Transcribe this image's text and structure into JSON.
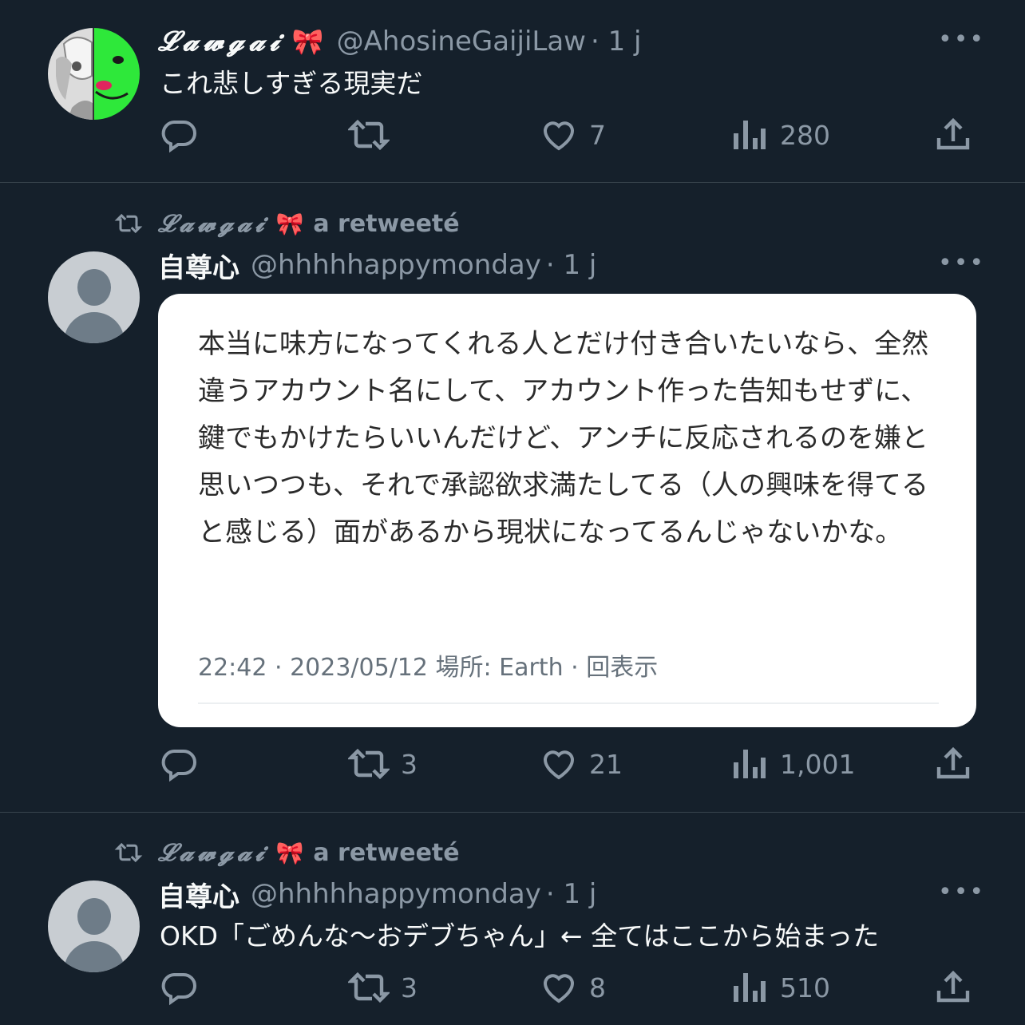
{
  "colors": {
    "background": "#15202b",
    "text_primary": "#f7f9f9",
    "text_secondary": "#8b98a5",
    "divider": "#38444d",
    "card_background": "#ffffff",
    "bow_pink": "#ff7aa8"
  },
  "tweets": [
    {
      "display_name": "𝓛𝓪𝔀𝓰𝓪𝓲",
      "bow": "🎀",
      "handle": "@AhosineGaijiLaw",
      "time": "· 1 j",
      "text": "これ悲しすぎる現実だ",
      "actions": {
        "reply": "",
        "retweet": "",
        "like": "7",
        "views": "280"
      }
    },
    {
      "retweeted_by": "𝓛𝓪𝔀𝓰𝓪𝓲",
      "retweeted_bow": "🎀",
      "retweet_label": "a retweeté",
      "display_name": "自尊心",
      "handle": "@hhhhhappymonday",
      "time": "· 1 j",
      "card": {
        "text": "本当に味方になってくれる人とだけ付き合いたいなら、全然違うアカウント名にして、アカウント作った告知もせずに、鍵でもかけたらいいんだけど、アンチに反応されるのを嫌と思いつつも、それで承認欲求満たしてる（人の興味を得てると感じる）面があるから現状になってるんじゃないかな。",
        "meta": "22:42 · 2023/05/12 場所: Earth · 回表示"
      },
      "actions": {
        "reply": "",
        "retweet": "3",
        "like": "21",
        "views": "1,001"
      }
    },
    {
      "retweeted_by": "𝓛𝓪𝔀𝓰𝓪𝓲",
      "retweeted_bow": "🎀",
      "retweet_label": "a retweeté",
      "display_name": "自尊心",
      "handle": "@hhhhhappymonday",
      "time": "· 1 j",
      "text": "OKD「ごめんな〜おデブちゃん」← 全てはここから始まった",
      "actions": {
        "reply": "",
        "retweet": "3",
        "like": "8",
        "views": "510"
      }
    }
  ]
}
